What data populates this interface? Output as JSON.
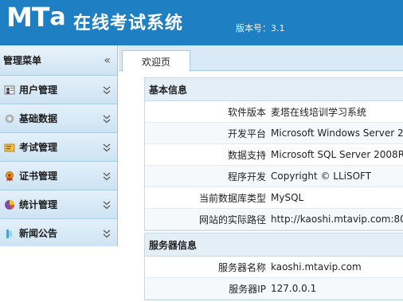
{
  "header": {
    "logo_main": "MT",
    "logo_a": "a",
    "title": "在线考试系统",
    "version": "版本号：3.1"
  },
  "sidebar": {
    "title": "管理菜单",
    "collapse_glyph": "«",
    "items": [
      {
        "label": "用户管理",
        "icon": "users-icon"
      },
      {
        "label": "基础数据",
        "icon": "gear-icon"
      },
      {
        "label": "考试管理",
        "icon": "exam-icon"
      },
      {
        "label": "证书管理",
        "icon": "certificate-icon"
      },
      {
        "label": "统计管理",
        "icon": "pie-chart-icon"
      },
      {
        "label": "新闻公告",
        "icon": "news-icon"
      }
    ]
  },
  "tabs": [
    {
      "label": "欢迎页",
      "active": true
    }
  ],
  "basic_info": {
    "title": "基本信息",
    "rows": [
      {
        "key": "软件版本",
        "value": "麦塔在线培训学习系统"
      },
      {
        "key": "开发平台",
        "value": "Microsoft Windows Server 2"
      },
      {
        "key": "数据支持",
        "value": "Microsoft SQL Server 2008R"
      },
      {
        "key": "程序开发",
        "value": "Copyright © LLiSOFT"
      },
      {
        "key": "当前数据库类型",
        "value": "MySQL"
      },
      {
        "key": "网站的实际路径",
        "value": "http://kaoshi.mtavip.com:80"
      }
    ]
  },
  "server_info": {
    "title": "服务器信息",
    "rows": [
      {
        "key": "服务器名称",
        "value": "kaoshi.mtavip.com"
      },
      {
        "key": "服务器IP",
        "value": "127.0.0.1"
      }
    ]
  },
  "colors": {
    "header_bg": "#1f7fc3",
    "sidebar_bg": "#d3e7f5",
    "panel_head_bg": "#e3eef7"
  }
}
